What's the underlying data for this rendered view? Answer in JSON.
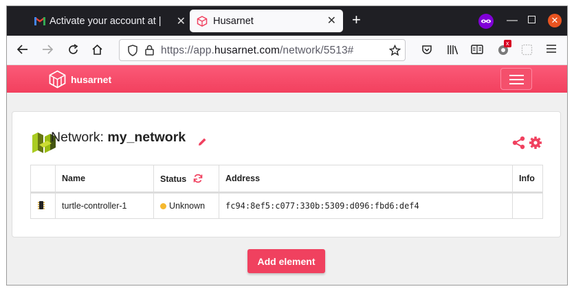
{
  "browser": {
    "tabs": [
      {
        "title": "Activate your account at |",
        "active": false
      },
      {
        "title": "Husarnet",
        "active": true
      }
    ],
    "url": {
      "prefix": "https://app.",
      "domain": "husarnet.com",
      "path": "/network/5513#"
    },
    "extension_badge": "x"
  },
  "app": {
    "brand": "husarnet",
    "network_label": "Network:",
    "network_name": "my_network",
    "table": {
      "columns": [
        "",
        "Name",
        "Status",
        "Address",
        "Info"
      ],
      "rows": [
        {
          "name": "turtle-controller-1",
          "status": "Unknown",
          "address": "fc94:8ef5:c077:330b:5309:d096:fbd6:def4",
          "info": ""
        }
      ]
    },
    "add_button": "Add element"
  },
  "colors": {
    "accent": "#f0415f",
    "header_top": "#fb5a78",
    "status_unknown": "#f5b82e"
  }
}
